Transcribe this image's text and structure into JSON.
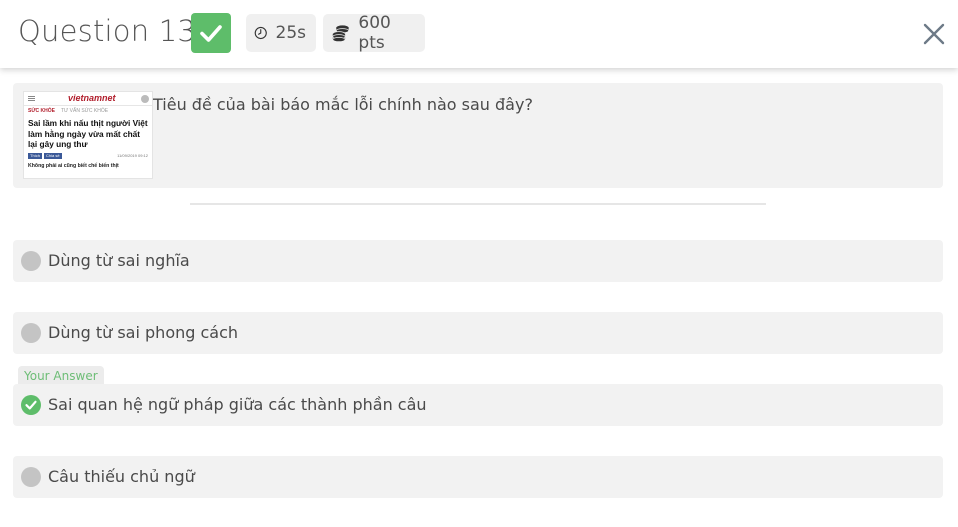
{
  "header": {
    "title": "Question 13",
    "timer": "25s",
    "points": "600 pts"
  },
  "question": {
    "text": "Tiêu đề của bài báo mắc lỗi chính nào sau đây?",
    "thumbnail": {
      "logo": "vietnamnet",
      "category": "SỨC KHỎE",
      "subcategory": "TƯ VẤN SỨC KHỎE",
      "headline": "Sai lầm khi nấu thịt người Việt làm hằng ngày vừa mất chất lại gây ung thư",
      "like_label": "Thích",
      "share_label": "Chia sẻ",
      "date": "11/09/2019 09:12",
      "sub_headline": "Không phải ai cũng biết chế biến thịt"
    }
  },
  "your_answer_label": "Your Answer",
  "options": [
    {
      "label": "Dùng từ sai nghĩa",
      "state": "unselected"
    },
    {
      "label": "Dùng từ sai phong cách",
      "state": "unselected"
    },
    {
      "label": "Sai quan hệ ngữ pháp giữa các thành phần câu",
      "state": "correct"
    },
    {
      "label": "Câu thiếu chủ ngữ",
      "state": "unselected"
    }
  ],
  "colors": {
    "correct": "#5ebd6a",
    "option_bg": "#f2f2f2",
    "chip_bg": "#f0f0f0",
    "radio": "#c4c4c4"
  },
  "icons": {
    "badge": "checkmark-icon",
    "timer": "clock-icon",
    "points": "coins-icon",
    "close": "close-icon"
  }
}
